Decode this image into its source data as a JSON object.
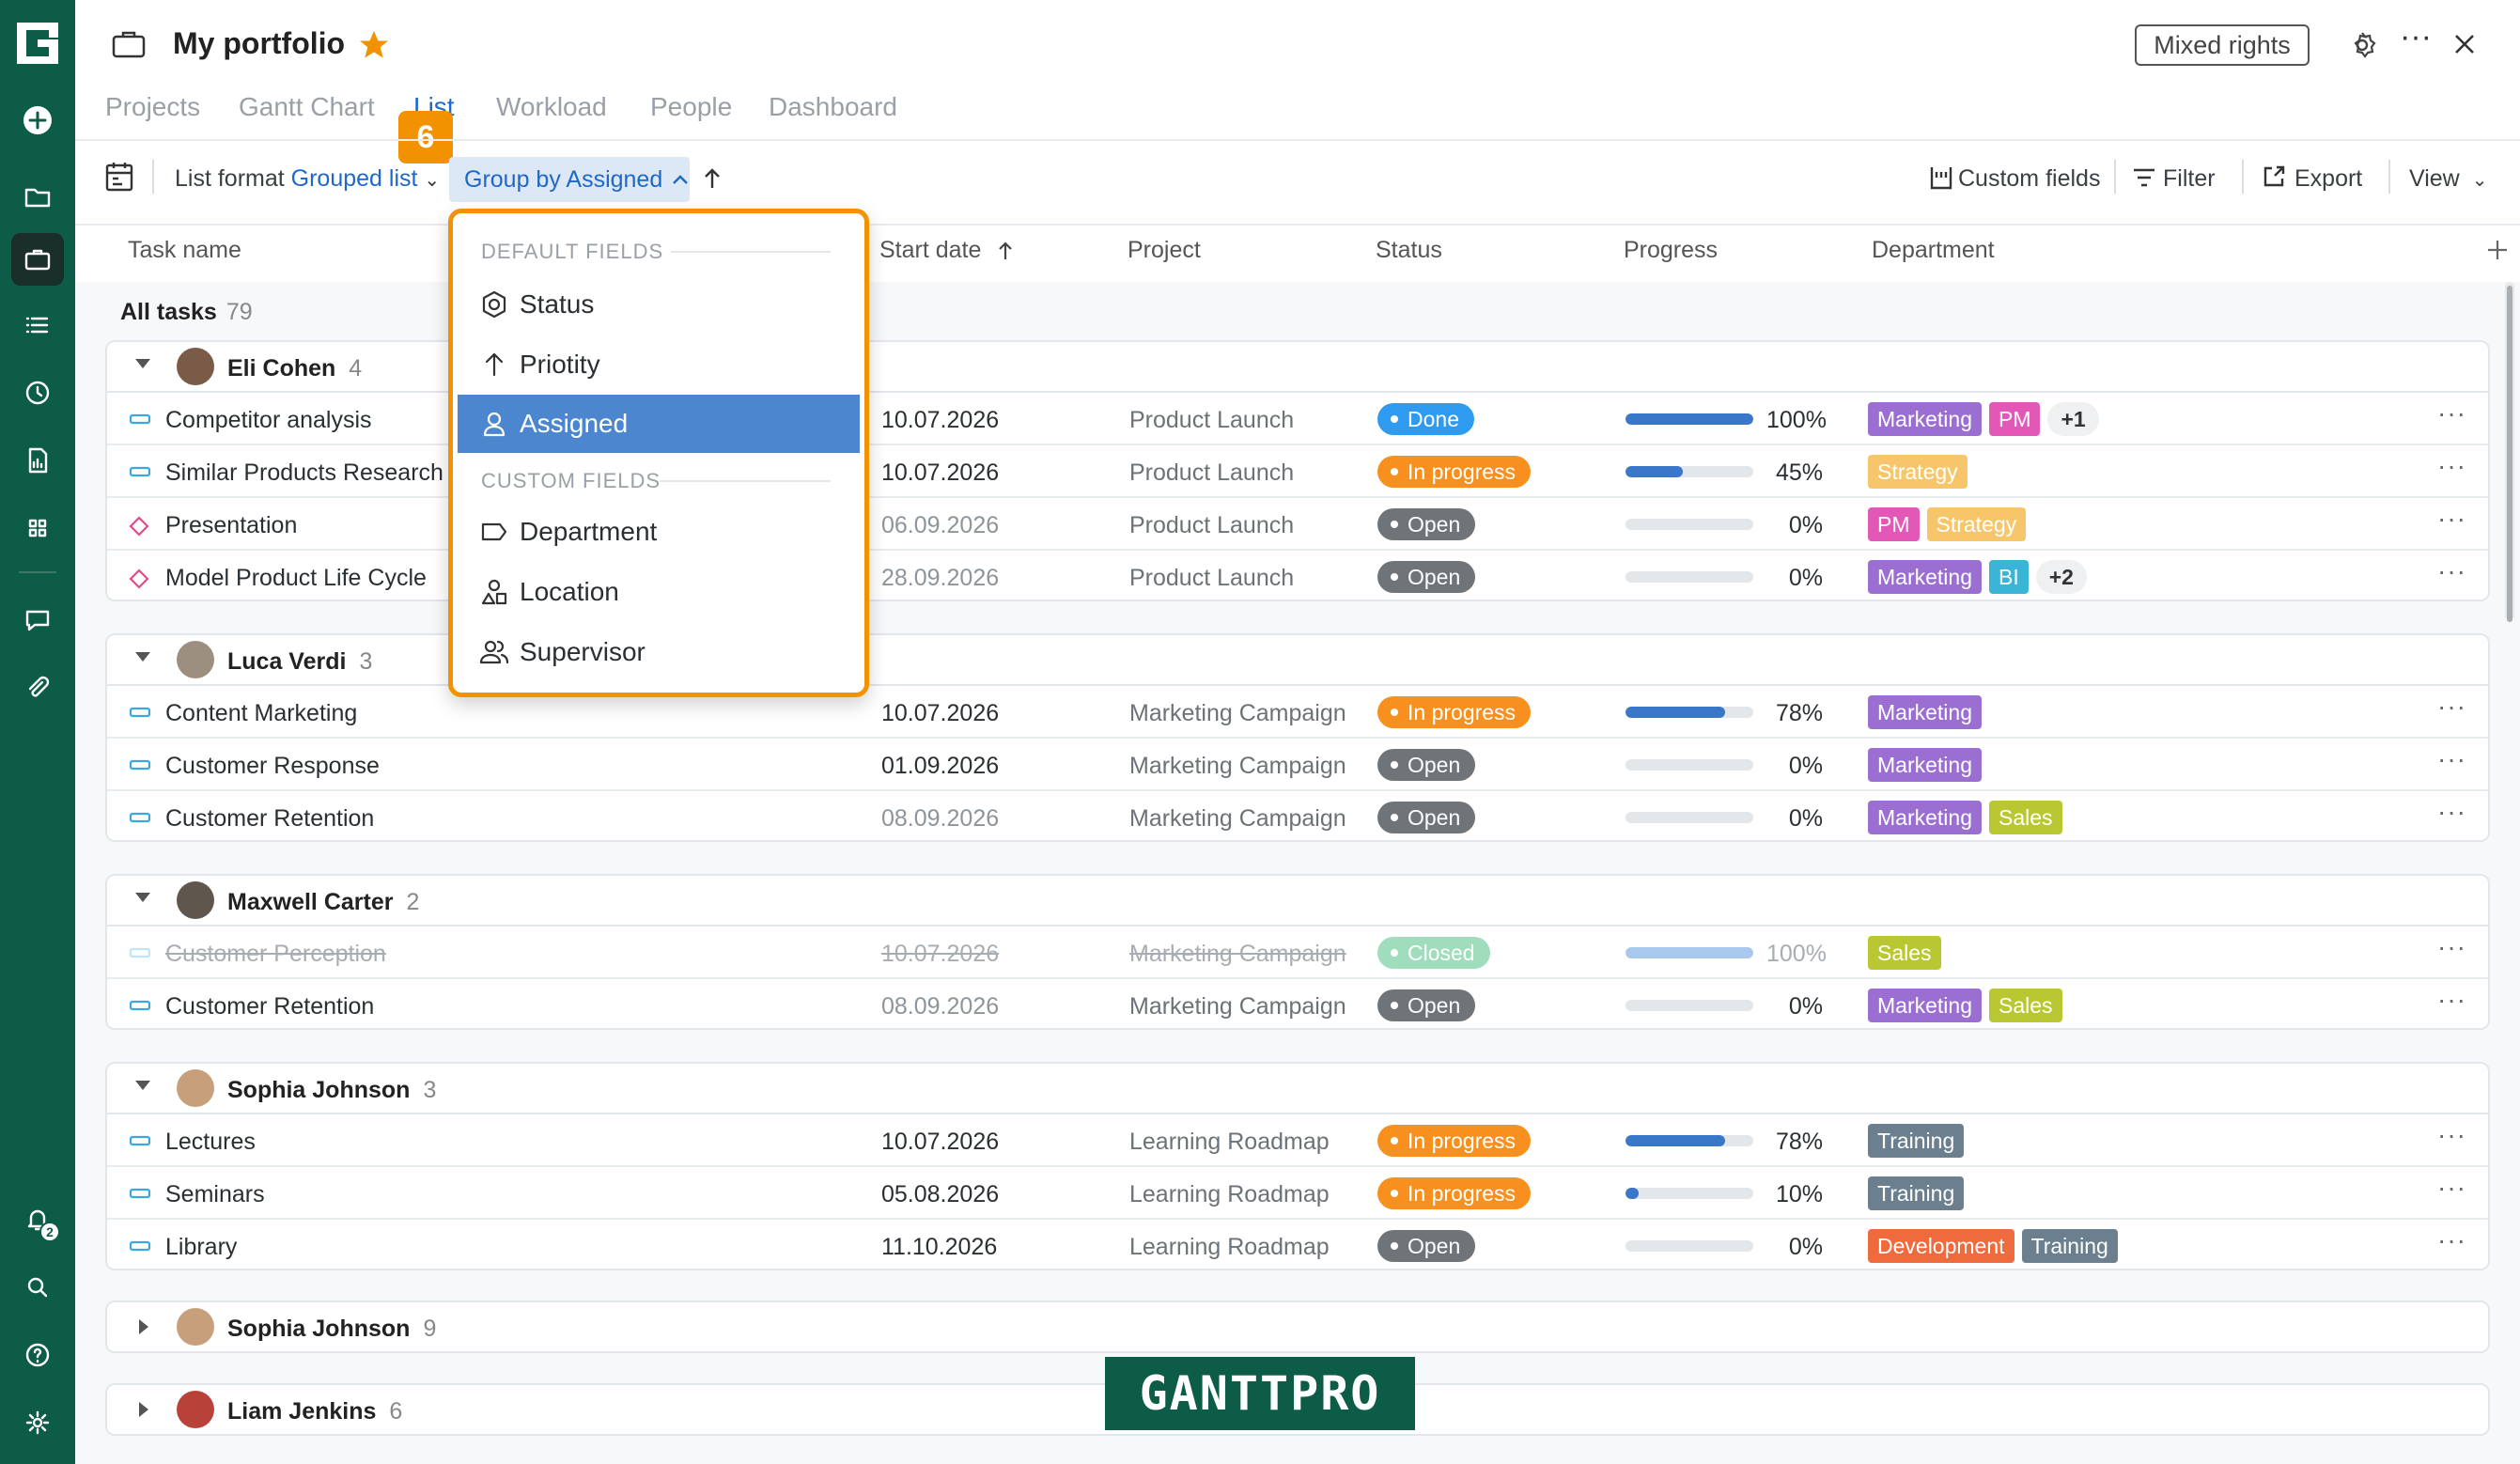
{
  "header": {
    "title": "My portfolio",
    "mixed_rights": "Mixed rights"
  },
  "tabs": [
    "Projects",
    "Gantt Chart",
    "List",
    "Workload",
    "People",
    "Dashboard"
  ],
  "step_badge": "6",
  "toolbar": {
    "list_format_label": "List format",
    "list_format_value": "Grouped list",
    "group_by": "Group by Assigned",
    "custom_fields": "Custom fields",
    "filter": "Filter",
    "export": "Export",
    "view": "View"
  },
  "columns": {
    "task_name": "Task name",
    "start_date": "Start date",
    "project": "Project",
    "status": "Status",
    "progress": "Progress",
    "department": "Department"
  },
  "all_tasks": {
    "label": "All tasks",
    "count": "79"
  },
  "dropdown": {
    "default_header": "DEFAULT FIELDS",
    "custom_header": "CUSTOM FIELDS",
    "items": [
      "Status",
      "Priotity",
      "Assigned",
      "Department",
      "Location",
      "Supervisor"
    ],
    "selected": "Assigned"
  },
  "groups": [
    {
      "name": "Eli Cohen",
      "count": "4",
      "tasks": [
        {
          "name": "Competitor analysis",
          "date": "10.07.2026",
          "project": "Product Launch",
          "status": "Done",
          "progress": "100%",
          "tags": [
            "Marketing",
            "PM",
            "+1"
          ]
        },
        {
          "name": "Similar Products Research",
          "date": "10.07.2026",
          "project": "Product Launch",
          "status": "In progress",
          "progress": "45%",
          "tags": [
            "Strategy"
          ]
        },
        {
          "name": "Presentation",
          "date": "06.09.2026",
          "project": "Product Launch",
          "status": "Open",
          "progress": "0%",
          "tags": [
            "PM",
            "Strategy"
          ]
        },
        {
          "name": "Model Product Life Cycle",
          "date": "28.09.2026",
          "project": "Product Launch",
          "status": "Open",
          "progress": "0%",
          "tags": [
            "Marketing",
            "BI",
            "+2"
          ]
        }
      ]
    },
    {
      "name": "Luca Verdi",
      "count": "3",
      "tasks": [
        {
          "name": "Content Marketing",
          "date": "10.07.2026",
          "project": "Marketing Campaign",
          "status": "In progress",
          "progress": "78%",
          "tags": [
            "Marketing"
          ]
        },
        {
          "name": "Customer Response",
          "date": "01.09.2026",
          "project": "Marketing Campaign",
          "status": "Open",
          "progress": "0%",
          "tags": [
            "Marketing"
          ]
        },
        {
          "name": "Customer Retention",
          "date": "08.09.2026",
          "project": "Marketing Campaign",
          "status": "Open",
          "progress": "0%",
          "tags": [
            "Marketing",
            "Sales"
          ]
        }
      ]
    },
    {
      "name": "Maxwell Carter",
      "count": "2",
      "tasks": [
        {
          "name": "Customer Perception",
          "date": "10.07.2026",
          "project": "Marketing Campaign",
          "status": "Closed",
          "progress": "100%",
          "tags": [
            "Sales"
          ]
        },
        {
          "name": "Customer Retention",
          "date": "08.09.2026",
          "project": "Marketing Campaign",
          "status": "Open",
          "progress": "0%",
          "tags": [
            "Marketing",
            "Sales"
          ]
        }
      ]
    },
    {
      "name": "Sophia Johnson",
      "count": "3",
      "tasks": [
        {
          "name": "Lectures",
          "date": "10.07.2026",
          "project": "Learning Roadmap",
          "status": "In progress",
          "progress": "78%",
          "tags": [
            "Training"
          ]
        },
        {
          "name": "Seminars",
          "date": "05.08.2026",
          "project": "Learning Roadmap",
          "status": "In progress",
          "progress": "10%",
          "tags": [
            "Training"
          ]
        },
        {
          "name": "Library",
          "date": "11.10.2026",
          "project": "Learning Roadmap",
          "status": "Open",
          "progress": "0%",
          "tags": [
            "Development",
            "Training"
          ]
        }
      ]
    },
    {
      "name": "Sophia Johnson",
      "count": "9",
      "tasks": []
    },
    {
      "name": "Liam Jenkins",
      "count": "6",
      "tasks": []
    }
  ],
  "tag_colors": {
    "Marketing": "#9b6fd1",
    "PM": "#e357b6",
    "Strategy": "#f7c66b",
    "BI": "#3ab5d6",
    "Sales": "#b9c832",
    "Training": "#6b7f8f",
    "Development": "#ef6b3e"
  },
  "notification_count": "2",
  "watermark": "GANTTPRO"
}
